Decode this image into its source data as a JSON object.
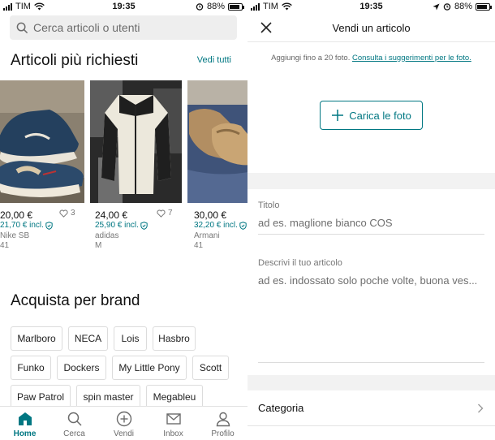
{
  "status_left": {
    "carrier": "TIM",
    "time": "19:35",
    "battery": "88%"
  },
  "status_right": {
    "carrier": "TIM",
    "time": "19:35",
    "battery": "88%"
  },
  "search": {
    "placeholder": "Cerca articoli o utenti"
  },
  "popular": {
    "title": "Articoli più richiesti",
    "see_all": "Vedi tutti"
  },
  "products": [
    {
      "price": "20,00 €",
      "price_incl": "21,70 € incl.",
      "brand": "Nike SB",
      "size": "41",
      "likes": "3"
    },
    {
      "price": "24,00 €",
      "price_incl": "25,90 € incl.",
      "brand": "adidas",
      "size": "M",
      "likes": "7"
    },
    {
      "price": "30,00 €",
      "price_incl": "32,20 € incl.",
      "brand": "Armani",
      "size": "41",
      "likes": ""
    }
  ],
  "brands_section": {
    "title": "Acquista per brand",
    "items": [
      "Marlboro",
      "NECA",
      "Lois",
      "Hasbro",
      "Funko",
      "Dockers",
      "My Little Pony",
      "Scott",
      "Paw Patrol",
      "spin master",
      "Megableu"
    ]
  },
  "tabbar": {
    "items": [
      {
        "label": "Home",
        "icon": "home-icon",
        "active": true
      },
      {
        "label": "Cerca",
        "icon": "search-icon",
        "active": false
      },
      {
        "label": "Vendi",
        "icon": "plus-circle-icon",
        "active": false
      },
      {
        "label": "Inbox",
        "icon": "mail-icon",
        "active": false
      },
      {
        "label": "Profilo",
        "icon": "user-icon",
        "active": false
      }
    ]
  },
  "sell": {
    "title": "Vendi un articolo",
    "photo_hint": "Aggiungi fino a 20 foto.",
    "photo_hint_link": "Consulta i suggerimenti per le foto.",
    "upload_label": "Carica le foto",
    "title_field": {
      "label": "Titolo",
      "placeholder": "ad es. maglione bianco COS"
    },
    "desc_field": {
      "label": "Descrivi il tuo articolo",
      "placeholder": "ad es. indossato solo poche volte, buona ves..."
    },
    "category_label": "Categoria"
  },
  "colors": {
    "accent": "#007782",
    "band": "#f2f2f2"
  }
}
